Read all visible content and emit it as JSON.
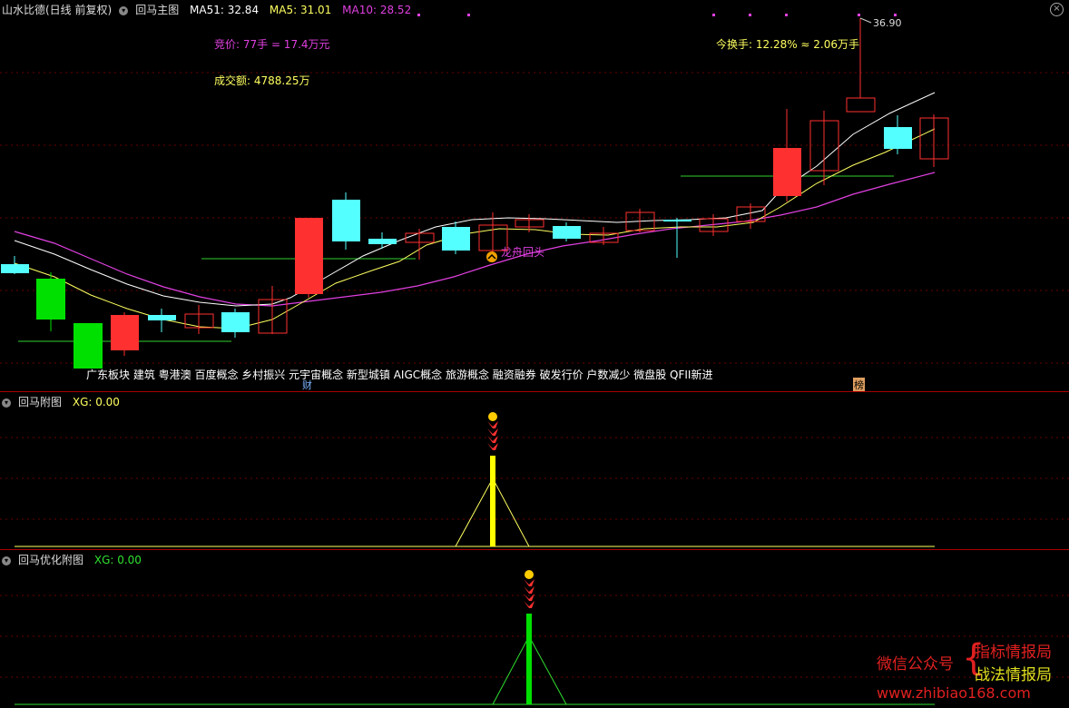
{
  "main": {
    "stock_name": "山水比德(日线 前复权)",
    "chart_name": "回马主图",
    "ma51_label": "MA51: 32.84",
    "ma5_label": "MA5: 31.01",
    "ma10_label": "MA10: 28.52",
    "bid_text": "竞价: 77手 = 17.4万元",
    "volume_text": "成交额: 4788.25万",
    "turnover_text": "今换手: 12.28% ≈ 2.06万手",
    "high_price_label": "36.90",
    "signal_text": "龙舟回头",
    "concepts_text": "广东板块 建筑 粤港澳 百度概念 乡村振兴 元宇宙概念 新型城镇 AIGC概念 旅游概念 融资融券 破发行价 户数减少 微盘股 QFII新进",
    "tag_cai": "财",
    "tag_bang": "榜"
  },
  "sub1": {
    "name": "回马附图",
    "xg_label": "XG: 0.00"
  },
  "sub2": {
    "name": "回马优化附图",
    "xg_label": "XG: 0.00"
  },
  "watermark": {
    "wechat": "微信公众号",
    "brace": "{",
    "line1": "指标情报局",
    "line2": "战法情报局",
    "url": "www.zhibiao168.com"
  },
  "colors": {
    "up": "#ff3030",
    "down_cyan": "#54ffff",
    "down_green": "#00e000",
    "ma_white": "#ffffff",
    "ma_yellow": "#ffff60",
    "ma_magenta": "#e040e0",
    "grid": "#7a0000"
  }
}
